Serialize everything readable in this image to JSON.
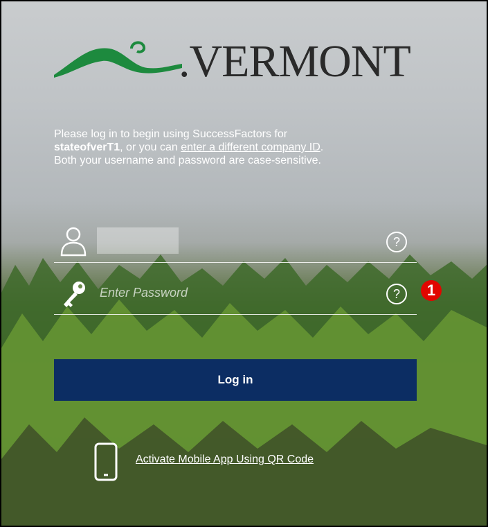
{
  "logo": {
    "text": ".VERMONT",
    "mountain_color": "#1d8a3e"
  },
  "intro": {
    "line1": "Please log in to begin using SuccessFactors for",
    "company": "stateofverT1",
    "mid": ", or you can ",
    "link": "enter a different company ID",
    "end": ".",
    "line3": "Both your username and password are case-sensitive."
  },
  "username": {
    "icon": "user-icon",
    "value": "",
    "help": "?"
  },
  "password": {
    "icon": "key-icon",
    "placeholder": "Enter Password",
    "help": "?"
  },
  "annotation": {
    "label": "1",
    "color": "#e10600"
  },
  "login": {
    "label": "Log in",
    "color": "#0c2d63"
  },
  "mobile": {
    "icon": "mobile-phone-icon",
    "link": "Activate Mobile App Using QR Code"
  }
}
